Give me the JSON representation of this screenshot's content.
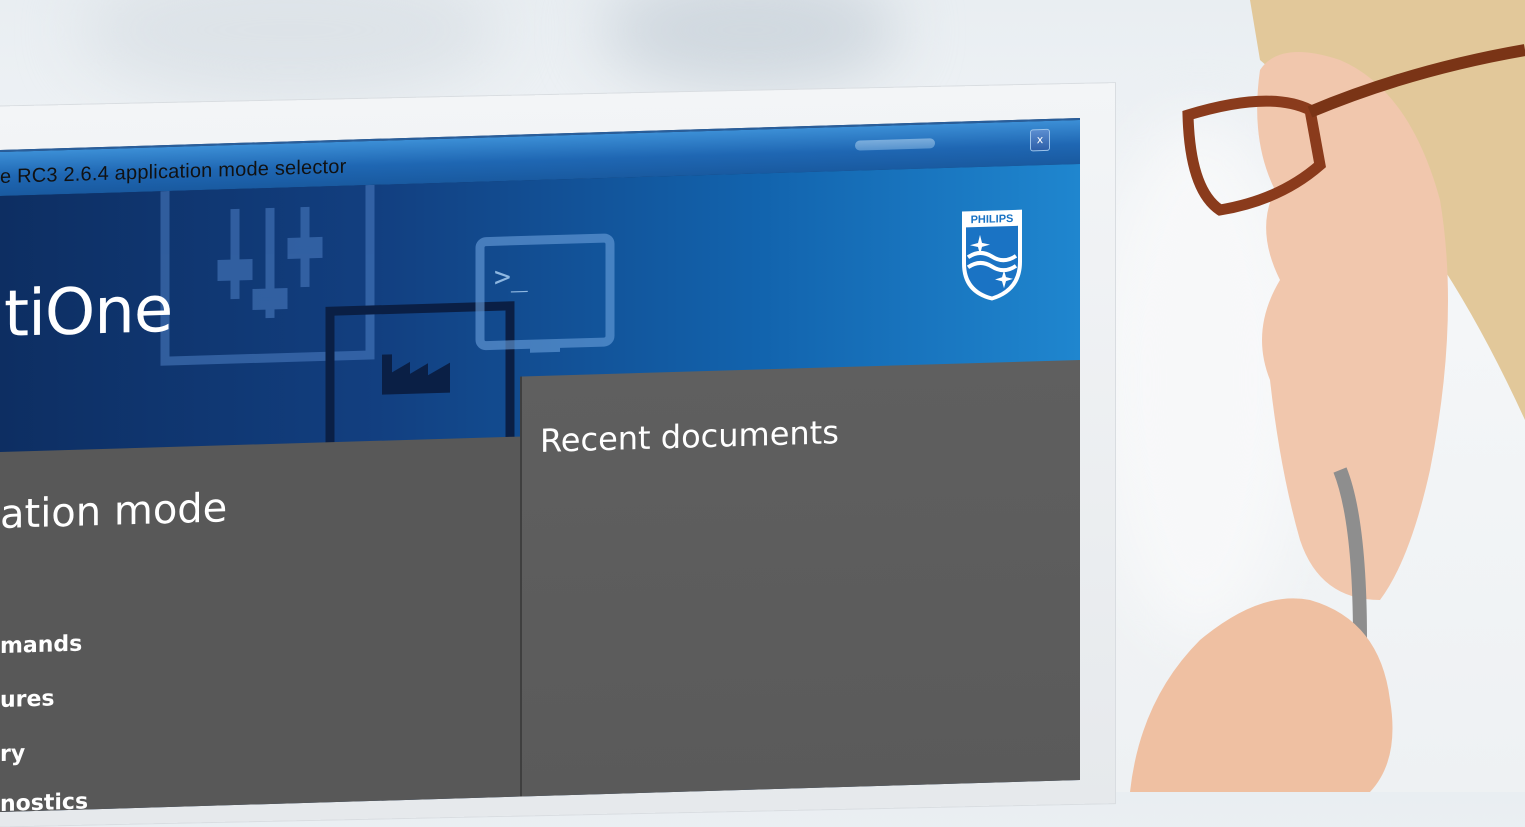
{
  "window": {
    "title": "e RC3 2.6.4  application mode selector",
    "close_label": "x"
  },
  "hero": {
    "app_name": "tiOne",
    "logo_text": "PHILIPS",
    "terminal_glyph": ">_"
  },
  "left_panel": {
    "heading": "ation mode",
    "items": [
      "mands",
      "ures",
      "ry",
      "nostics"
    ]
  },
  "right_panel": {
    "heading": "Recent documents"
  },
  "colors": {
    "titlebar": "#1f67b3",
    "hero_dark": "#0d2e62",
    "hero_light": "#1f86cf",
    "panel_gray": "#585858"
  }
}
